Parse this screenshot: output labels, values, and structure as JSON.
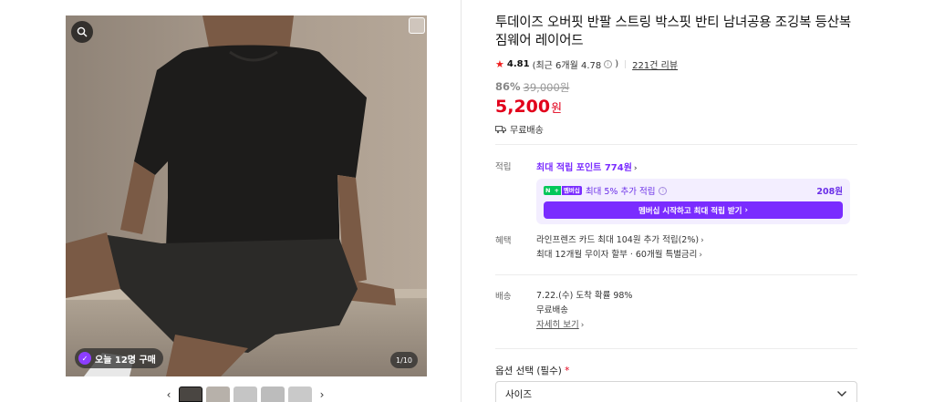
{
  "gallery": {
    "buyers_badge": "오늘 12명 구매",
    "counter": "1/10",
    "thumbnail_count": 5
  },
  "product": {
    "title": "투데이즈 오버핏 반팔 스트링 박스핏 반티 남녀공용 조깅복 등산복 짐웨어 레이어드",
    "rating": "4.81",
    "recent_rating": "(최근 6개월 4.78",
    "recent_rating_close": ")",
    "reviews": "221건 리뷰",
    "discount": "86%",
    "original_price": "39,000원",
    "price": "5,200",
    "price_unit": "원",
    "shipping": "무료배송"
  },
  "points": {
    "label": "적립",
    "max_points": "최대 적립 포인트 774원",
    "promo_text": "최대 5% 추가 적립",
    "promo_amount": "208원",
    "promo_button": "멤버십 시작하고 최대 적립 받기",
    "npay_n": "N",
    "npay_plus": "+",
    "npay_m": "멤버십"
  },
  "benefits": {
    "label": "혜택",
    "line1": "라인프렌즈 카드 최대 104원 추가 적립(2%)",
    "line2": "최대 12개월 무이자 할부 · 60개월 특별금리"
  },
  "delivery": {
    "label": "배송",
    "arrival": "7.22.(수) 도착 확률 98%",
    "fee": "무료배송",
    "detail_link": "자세히 보기"
  },
  "options": {
    "label": "옵션 선택 (필수)",
    "required_mark": "*",
    "size_select": "사이즈"
  },
  "colors": {
    "accent_purple": "#7a2cff",
    "price_red": "#e2001b",
    "star_red": "#f01e1e"
  }
}
